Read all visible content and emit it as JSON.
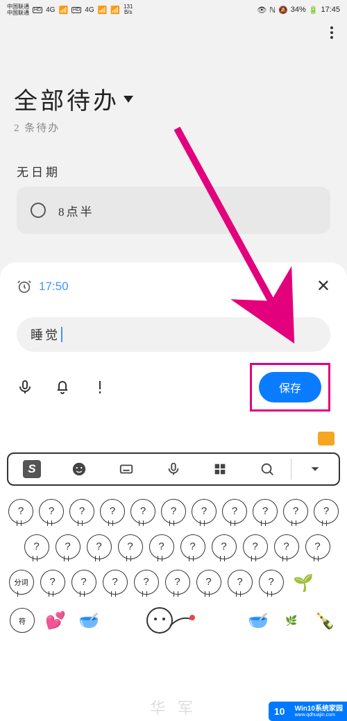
{
  "statusbar": {
    "carrier": "中国联通",
    "net_speed_num": "131",
    "net_speed_unit": "B/s",
    "sig_4g": "4G",
    "hd": "HD",
    "battery_pct": "34%",
    "time": "17:45"
  },
  "header": {
    "title": "全部待办",
    "subtitle": "2 条待办"
  },
  "section": {
    "no_date": "无日期"
  },
  "todo": {
    "item1": "8点半"
  },
  "sheet": {
    "time": "17:50",
    "input_text": "睡觉",
    "save_label": "保存"
  },
  "keyboard": {
    "placeholder_symbol": "?",
    "fenxi": "分词",
    "fu": "符"
  },
  "watermark": {
    "logo": "10",
    "main": "Win10系统家园",
    "sub": "www.qdhuajin.com"
  },
  "ghost": "华 军"
}
